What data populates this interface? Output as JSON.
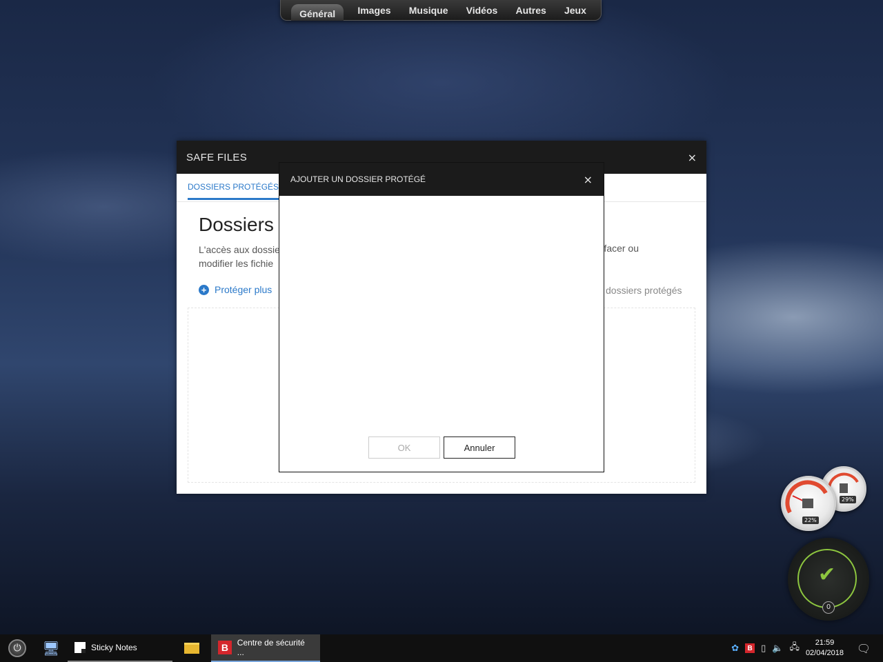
{
  "topbar": {
    "tabs": [
      "Général",
      "Images",
      "Musique",
      "Vidéos",
      "Autres",
      "Jeux"
    ]
  },
  "safe_files": {
    "title": "SAFE FILES",
    "close": "×",
    "tab": "DOSSIERS PROTÉGÉS",
    "heading": "Dossiers",
    "desc_line1": "L'accès aux dossie",
    "desc_line2": "modifier les fichie",
    "desc_right": "effacer ou",
    "protect_link": "Protéger plus",
    "protect_icon": "+",
    "count_text": "dossiers protégés"
  },
  "dialog": {
    "title": "AJOUTER UN DOSSIER PROTÉGÉ",
    "close": "×",
    "ok": "OK",
    "cancel": "Annuler"
  },
  "gadgets": {
    "cpu_percent": "22%",
    "mem_percent": "29%",
    "check_count": "0"
  },
  "taskbar": {
    "sticky_notes": "Sticky Notes",
    "security_center": "Centre de sécurité ...",
    "b_icon": "B",
    "time": "21:59",
    "date": "02/04/2018"
  }
}
